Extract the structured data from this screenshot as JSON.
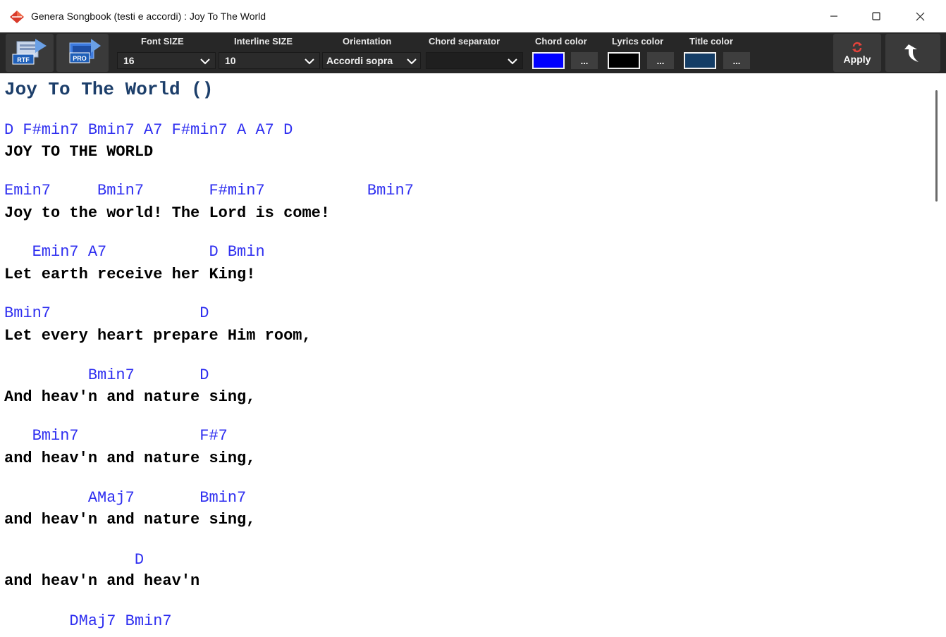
{
  "window": {
    "title": "Genera Songbook (testi e accordi) : Joy To The World",
    "app_icon": "diamond-app-icon",
    "controls": [
      "minimize-icon",
      "maximize-icon",
      "close-icon"
    ]
  },
  "toolbar": {
    "rtf_icon": "rtf-export-icon",
    "pro_icon": "pro-export-icon",
    "font_size": {
      "label": "Font SIZE",
      "value": "16"
    },
    "interline_size": {
      "label": "Interline SIZE",
      "value": "10"
    },
    "orientation": {
      "label": "Orientation",
      "value": "Accordi sopra"
    },
    "chord_separator": {
      "label": "Chord separator",
      "value": ""
    },
    "chord_color": {
      "label": "Chord color",
      "color": "#0000ff",
      "button": "..."
    },
    "lyrics_color": {
      "label": "Lyrics color",
      "color": "#000000",
      "button": "..."
    },
    "title_color": {
      "label": "Title color",
      "color": "#143d66",
      "button": "..."
    },
    "apply": {
      "label": "Apply",
      "icon": "refresh-icon"
    },
    "back_icon": "back-arrow-icon"
  },
  "song": {
    "title": "Joy To The World ()",
    "blocks": [
      {
        "chords": "D F#min7 Bmin7 A7 F#min7 A A7 D",
        "lyrics": "JOY TO THE WORLD"
      },
      {
        "chords": "Emin7     Bmin7       F#min7           Bmin7",
        "lyrics": "Joy to the world! The Lord is come!"
      },
      {
        "chords": "   Emin7 A7           D Bmin",
        "lyrics": "Let earth receive her King!"
      },
      {
        "chords": "Bmin7                D",
        "lyrics": "Let every heart prepare Him room,"
      },
      {
        "chords": "         Bmin7       D",
        "lyrics": "And heav'n and nature sing,"
      },
      {
        "chords": "   Bmin7             F#7",
        "lyrics": "and heav'n and nature sing,"
      },
      {
        "chords": "         AMaj7       Bmin7",
        "lyrics": "and heav'n and nature sing,"
      },
      {
        "chords": "              D",
        "lyrics": "and heav'n and heav'n"
      },
      {
        "chords": "       DMaj7 Bmin7",
        "lyrics": ""
      }
    ]
  },
  "colors": {
    "toolbar_bg": "#272727",
    "chord_text": "#2f2ff0",
    "title_text": "#1c3e6a"
  }
}
